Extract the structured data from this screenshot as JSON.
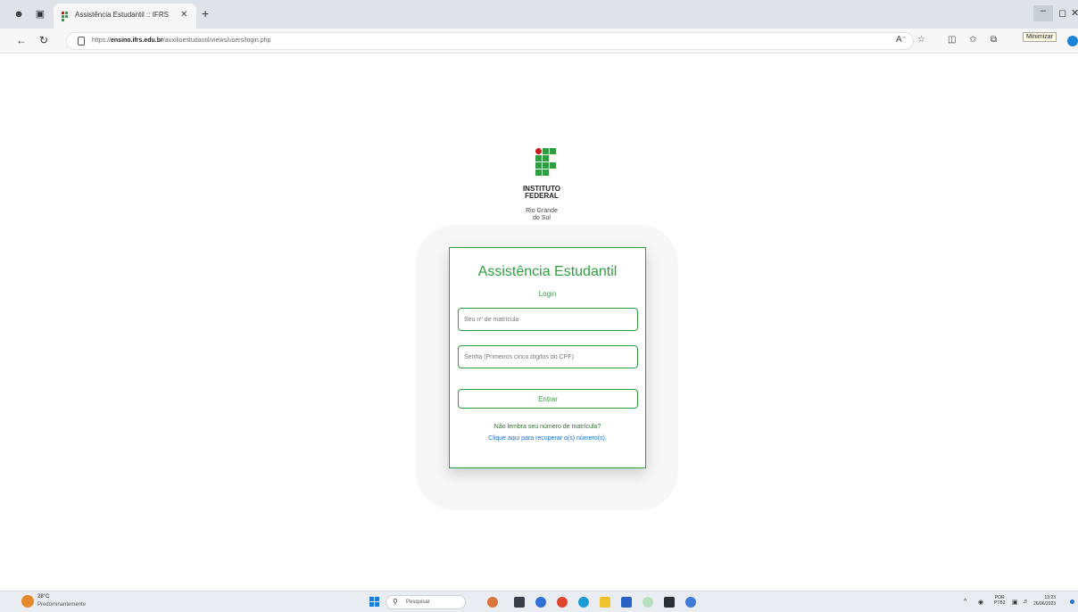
{
  "browser": {
    "tab_title": "Assistência Estudantil :: IFRS",
    "url_prefix": "https://",
    "url_domain": "ensino.ifrs.edu.br",
    "url_path": "/auxilioestudantil/views/users/login.php",
    "tooltip": "Minimizar"
  },
  "logo": {
    "line1": "INSTITUTO",
    "line2": "FEDERAL",
    "line3": "Rio Grande",
    "line4": "do Sul"
  },
  "login": {
    "title": "Assistência Estudantil",
    "subtitle": "Login",
    "matricula_placeholder": "Seu nº de matrícula",
    "senha_placeholder": "Senha (Primeiros cinco dígitos do CPF)",
    "submit_label": "Entrar",
    "forgot_text": "Não lembra seu número de matrícula?",
    "recover_link": "Clique aqui para recuperar o(s) número(s)."
  },
  "taskbar": {
    "weather_temp": "28°C",
    "weather_desc": "Predominantemente",
    "search_placeholder": "Pesquisar",
    "lang": "POR",
    "lang_sub": "PTB2",
    "time": "13:23",
    "date": "26/06/2023"
  },
  "colors": {
    "brand_green": "#2f9e41",
    "brand_red": "#c8191e",
    "link_blue": "#1a6fd6"
  }
}
